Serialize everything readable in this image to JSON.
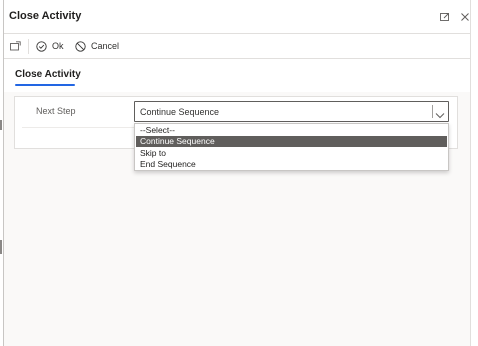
{
  "dialog": {
    "title": "Close Activity",
    "title_icons": [
      "expand-icon",
      "close-icon"
    ]
  },
  "toolbar": {
    "items": [
      {
        "icon": "popout-icon",
        "label": ""
      },
      {
        "icon": "check-circle-icon",
        "label": "Ok"
      },
      {
        "icon": "block-icon",
        "label": "Cancel"
      }
    ]
  },
  "tab": {
    "label": "Close Activity"
  },
  "form": {
    "next_step_label": "Next Step",
    "next_step_value": "Continue Sequence",
    "options": [
      "--Select--",
      "Continue Sequence",
      "Skip to",
      "End Sequence"
    ],
    "selected_index": 1
  },
  "colors": {
    "accent": "#2266e3",
    "selected_option_bg": "#605e5c",
    "background": "#faf9f8"
  }
}
